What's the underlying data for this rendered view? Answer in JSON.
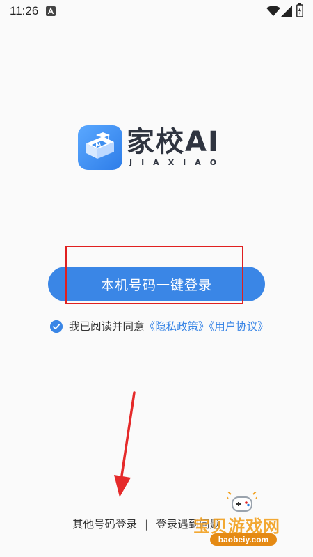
{
  "status_bar": {
    "time": "11:26",
    "icons": [
      "notification-a-icon",
      "wifi-icon",
      "signal-icon",
      "battery-icon"
    ]
  },
  "logo": {
    "title": "家校AI",
    "subtitle": "JIAXIAO",
    "icon_color": "#3d8ef0"
  },
  "login": {
    "button_label": "本机号码一键登录",
    "button_color": "#3a86e6"
  },
  "annotation": {
    "highlight_color": "#e02020"
  },
  "agreement": {
    "checked": true,
    "prefix": "我已阅读并同意",
    "privacy_link": "《隐私政策》",
    "user_agreement_link": "《用户协议》"
  },
  "footer": {
    "other_login": "其他号码登录",
    "separator": "|",
    "login_problem": "登录遇到问题"
  },
  "watermark": {
    "text": "宝贝游戏网",
    "url": "baobeiy.com"
  }
}
